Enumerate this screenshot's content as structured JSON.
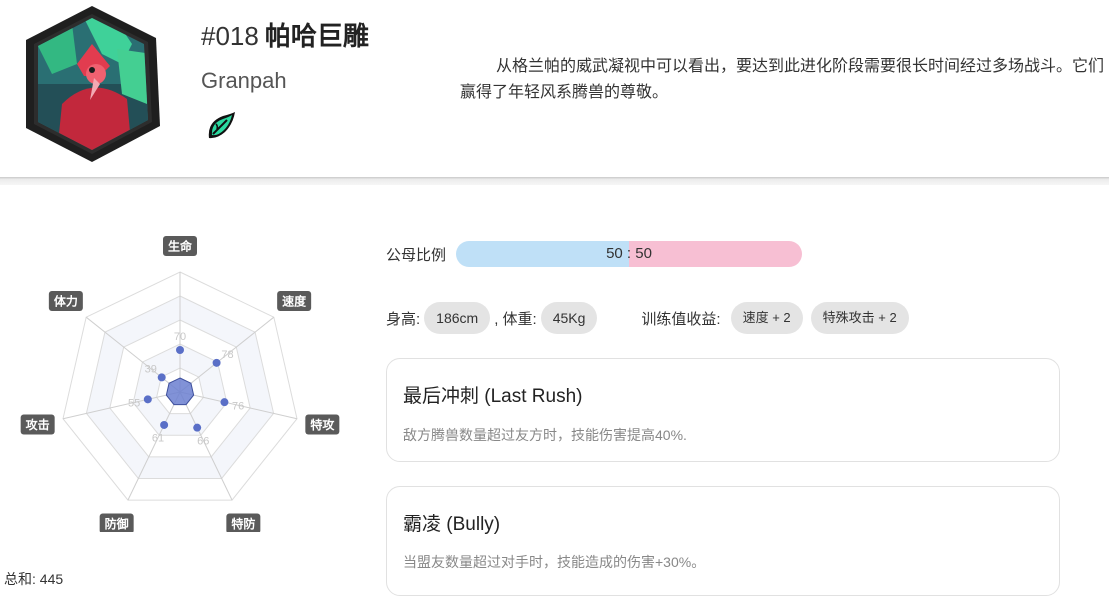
{
  "header": {
    "number": "#018",
    "name": "帕哈巨雕",
    "english_name": "Granpah",
    "description": "从格兰帕的威武凝视中可以看出，要达到此进化阶段需要很长时间经过多场战斗。它们赢得了年轻风系腾兽的尊敬。",
    "type_icon": "wind-leaf-icon",
    "accent_color": "#2bd9a0"
  },
  "radar": {
    "stats": [
      {
        "label": "生命",
        "value": "70"
      },
      {
        "label": "速度",
        "value": "78"
      },
      {
        "label": "特攻",
        "value": "76"
      },
      {
        "label": "特防",
        "value": "66"
      },
      {
        "label": "防御",
        "value": "61"
      },
      {
        "label": "攻击",
        "value": "55"
      },
      {
        "label": "体力",
        "value": "39"
      }
    ],
    "total_label": "总和: 445",
    "point_color": "#5a6fc7"
  },
  "gender": {
    "label": "公母比例",
    "ratio_text": "50 : 50",
    "male_fraction": 0.5,
    "female_fraction": 0.5
  },
  "info": {
    "height_label": "身高:",
    "height_value": "186cm",
    "weight_label": ", 体重:",
    "weight_value": "45Kg",
    "ev_label": "训练值收益:",
    "ev_items": [
      "速度 + 2",
      "特殊攻击 + 2"
    ]
  },
  "abilities": [
    {
      "title": "最后冲刺 (Last Rush)",
      "desc": "敌方腾兽数量超过友方时，技能伤害提高40%."
    },
    {
      "title": "霸凌 (Bully)",
      "desc": "当盟友数量超过对手时，技能造成的伤害+30%。"
    }
  ]
}
